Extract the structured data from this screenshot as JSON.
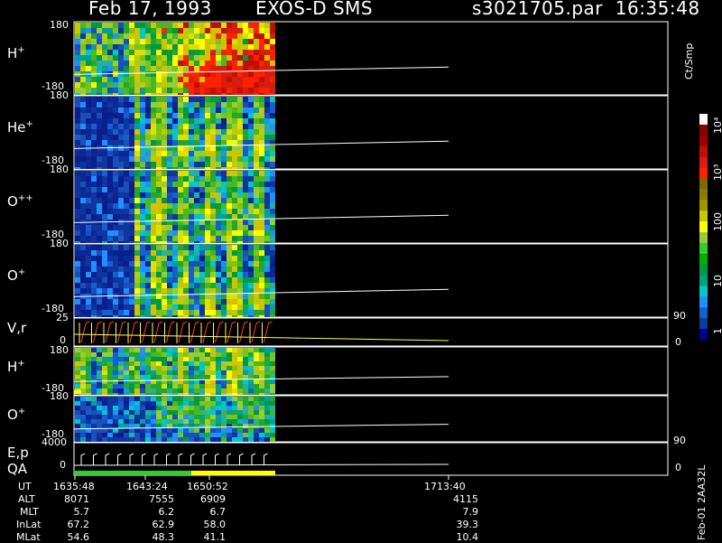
{
  "header": {
    "date": "Feb 17, 1993",
    "mission": "EXOS-D SMS",
    "file_time": "s3021705.par  16:35:48"
  },
  "panels": [
    {
      "label": "H",
      "sup": "+",
      "ymax": "180",
      "ymin": "-180"
    },
    {
      "label": "He",
      "sup": "+",
      "ymax": "180",
      "ymin": "-180"
    },
    {
      "label": "O",
      "sup": "++",
      "ymax": "180",
      "ymin": "-180"
    },
    {
      "label": "O",
      "sup": "+",
      "ymax": "180",
      "ymin": "-180"
    },
    {
      "label": "V,r",
      "ytop": "25",
      "ybot": "0",
      "rtop": "90",
      "rbot": "0"
    },
    {
      "label": "H",
      "sup": "+",
      "ymax": "180",
      "ymin": "-180"
    },
    {
      "label": "O",
      "sup": "+",
      "ymax": "180",
      "ymin": "-180"
    },
    {
      "label": "E,p",
      "label2": "QA",
      "ytop": "4000",
      "ybot": "0",
      "rtop": "90",
      "rbot": "0"
    }
  ],
  "colorbar": {
    "unit": "Ct/Smp",
    "ticks": [
      "10⁴",
      "10³",
      "100",
      "10",
      "1"
    ],
    "colors": [
      "#ffffff",
      "#8b0000",
      "#a00000",
      "#c01000",
      "#d81c10",
      "#ff2000",
      "#7a6a00",
      "#8a7e00",
      "#a09400",
      "#c8c800",
      "#ffff00",
      "#9acd32",
      "#32cd32",
      "#00b000",
      "#009a40",
      "#00a080",
      "#00c8c8",
      "#1e90ff",
      "#1560d0",
      "#0a3ca0",
      "#00008b"
    ]
  },
  "footer": {
    "rows": [
      {
        "label": "UT",
        "values": [
          "1635:48",
          "1643:24",
          "1650:52",
          "1713:40"
        ]
      },
      {
        "label": "ALT",
        "values": [
          "8071",
          "7555",
          "6909",
          "4115"
        ]
      },
      {
        "label": "MLT",
        "values": [
          "5.7",
          "6.2",
          "6.7",
          "7.9"
        ]
      },
      {
        "label": "InLat",
        "values": [
          "67.2",
          "62.9",
          "58.0",
          "39.3"
        ]
      },
      {
        "label": "MLat",
        "values": [
          "54.6",
          "48.3",
          "41.1",
          "10.4"
        ]
      }
    ],
    "side_label": "Feb-01 2AA32L"
  },
  "chart_data": {
    "type": "heatmap",
    "title": "Feb 17, 1993   EXOS-D SMS",
    "xlabel": "UT",
    "x_ticks": [
      "1635:48",
      "1643:24",
      "1650:52",
      "1713:40"
    ],
    "colorbar_label": "Ct/Smp",
    "colorbar_scale": "log",
    "colorbar_range": [
      1,
      10000
    ],
    "series": [
      {
        "name": "H+",
        "ylim": [
          -180,
          180
        ]
      },
      {
        "name": "He+",
        "ylim": [
          -180,
          180
        ]
      },
      {
        "name": "O++",
        "ylim": [
          -180,
          180
        ]
      },
      {
        "name": "O+",
        "ylim": [
          -180,
          180
        ]
      },
      {
        "name": "V,r",
        "ylim": [
          0,
          25
        ],
        "right_ylim": [
          0,
          90
        ]
      },
      {
        "name": "H+",
        "ylim": [
          -180,
          180
        ]
      },
      {
        "name": "O+",
        "ylim": [
          -180,
          180
        ]
      },
      {
        "name": "E,p",
        "ylim": [
          0,
          4000
        ],
        "right_ylim": [
          0,
          90
        ]
      }
    ],
    "annotations": {
      "rows": [
        "UT",
        "ALT",
        "MLT",
        "InLat",
        "MLat"
      ],
      "side_label": "Feb-01 2AA32L"
    }
  }
}
